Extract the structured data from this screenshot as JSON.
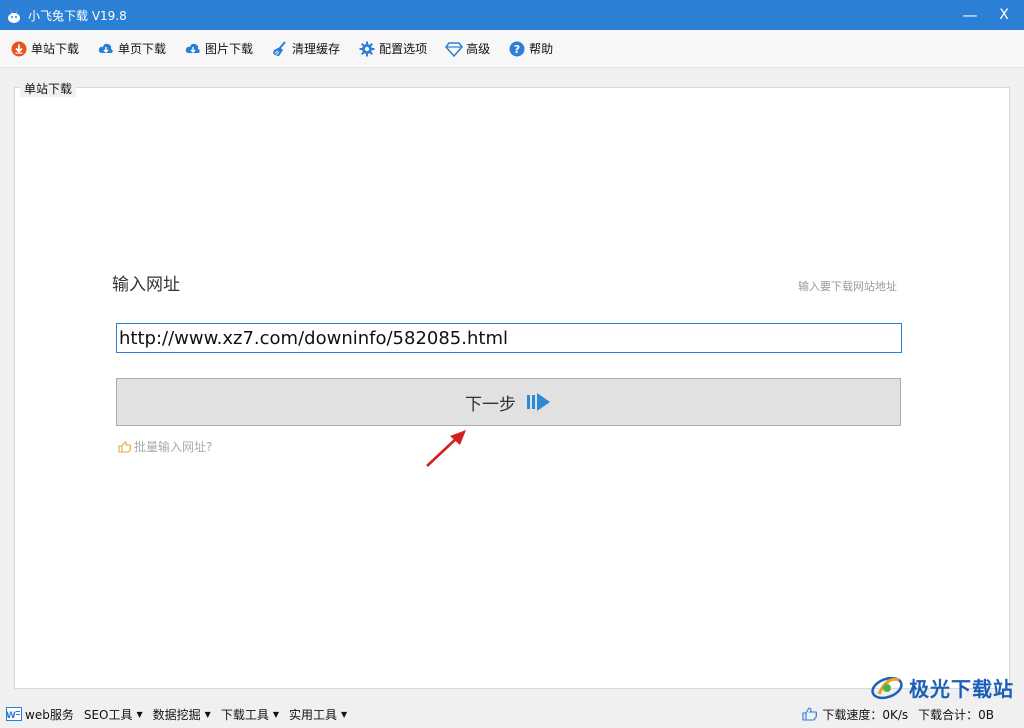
{
  "window": {
    "title": "小飞兔下载 V19.8",
    "minimize_label": "—",
    "close_label": "X"
  },
  "toolbar": {
    "items": [
      {
        "label": "单站下载",
        "icon": "cloud-download-icon",
        "color": "#e8541e"
      },
      {
        "label": "单页下载",
        "icon": "cloud-download-icon",
        "color": "#2b80d6"
      },
      {
        "label": "图片下载",
        "icon": "cloud-download-icon",
        "color": "#2b80d6"
      },
      {
        "label": "清理缓存",
        "icon": "broom-icon",
        "color": "#2b80d6"
      },
      {
        "label": "配置选项",
        "icon": "gear-icon",
        "color": "#2b80d6"
      },
      {
        "label": "高级",
        "icon": "diamond-icon",
        "color": "#2b80d6"
      },
      {
        "label": "帮助",
        "icon": "help-icon",
        "color": "#2b80d6"
      }
    ]
  },
  "panel": {
    "legend": "单站下载",
    "url_label": "输入网址",
    "url_hint": "输入要下载网站地址",
    "url_value": "http://www.xz7.com/downinfo/582085.html",
    "next_label": "下一步",
    "batch_label": "批量输入网址?"
  },
  "statusbar": {
    "menus": [
      {
        "label": "web服务",
        "has_caret": false
      },
      {
        "label": "SEO工具",
        "has_caret": true
      },
      {
        "label": "数据挖掘",
        "has_caret": true
      },
      {
        "label": "下载工具",
        "has_caret": true
      },
      {
        "label": "实用工具",
        "has_caret": true
      }
    ],
    "speed": "下载速度：0K/s",
    "total": "下载合计：0B"
  },
  "watermark": {
    "text": "极光下载站"
  },
  "colors": {
    "accent": "#2b80d6",
    "arrow": "#2b8ad6"
  }
}
